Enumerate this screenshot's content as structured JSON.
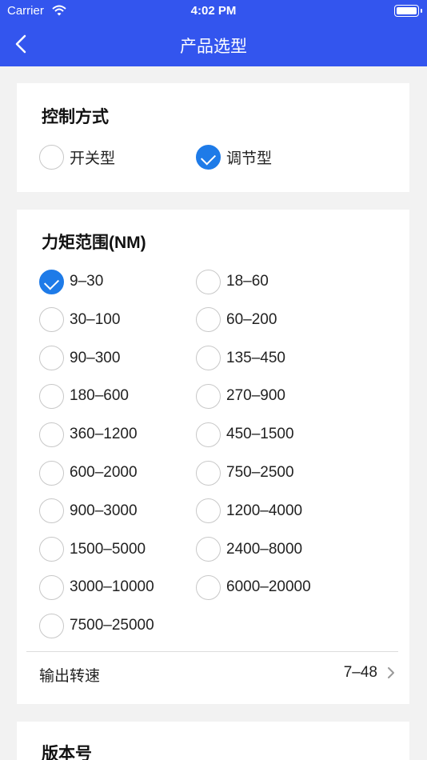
{
  "status_bar": {
    "carrier": "Carrier",
    "time": "4:02 PM",
    "icons": [
      "wifi-icon",
      "battery-icon"
    ]
  },
  "nav": {
    "title": "产品选型",
    "back_icon": "chevron-left-icon"
  },
  "colors": {
    "primary": "#3355ee",
    "check": "#1e7be8",
    "background": "#f2f2f2"
  },
  "control_mode": {
    "title": "控制方式",
    "options": [
      {
        "label": "开关型",
        "selected": false
      },
      {
        "label": "调节型",
        "selected": true
      }
    ]
  },
  "torque_range": {
    "title": "力矩范围(NM)",
    "options": [
      {
        "label": "9–30",
        "selected": true
      },
      {
        "label": "18–60",
        "selected": false
      },
      {
        "label": "30–100",
        "selected": false
      },
      {
        "label": "60–200",
        "selected": false
      },
      {
        "label": "90–300",
        "selected": false
      },
      {
        "label": "135–450",
        "selected": false
      },
      {
        "label": "180–600",
        "selected": false
      },
      {
        "label": "270–900",
        "selected": false
      },
      {
        "label": "360–1200",
        "selected": false
      },
      {
        "label": "450–1500",
        "selected": false
      },
      {
        "label": "600–2000",
        "selected": false
      },
      {
        "label": "750–2500",
        "selected": false
      },
      {
        "label": "900–3000",
        "selected": false
      },
      {
        "label": "1200–4000",
        "selected": false
      },
      {
        "label": "1500–5000",
        "selected": false
      },
      {
        "label": "2400–8000",
        "selected": false
      },
      {
        "label": "3000–10000",
        "selected": false
      },
      {
        "label": "6000–20000",
        "selected": false
      },
      {
        "label": "7500–25000",
        "selected": false
      }
    ],
    "output_speed": {
      "label": "输出转速",
      "value": "7–48",
      "icon": "chevron-right-icon"
    }
  },
  "version": {
    "title": "版本号"
  }
}
